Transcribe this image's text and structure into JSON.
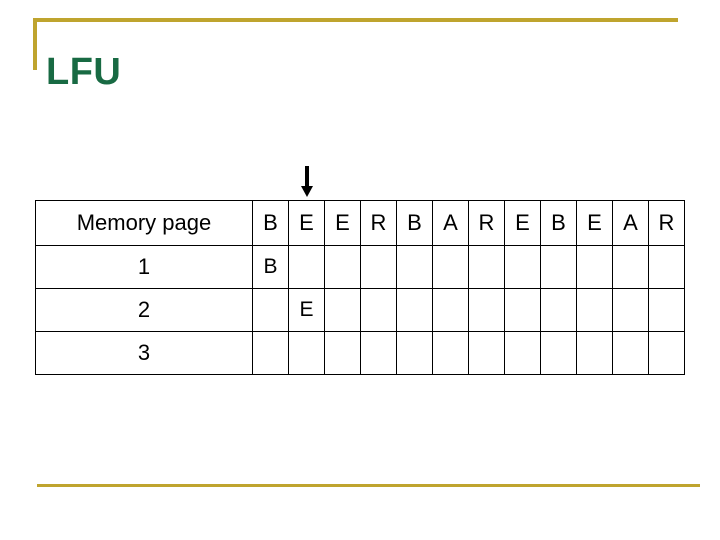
{
  "slide": {
    "title": "LFU",
    "title_color": "#186a43",
    "rule_color": "#bfa42e"
  },
  "marker": {
    "icon": "down-arrow-icon",
    "points_to_column_index": 1,
    "color": "#000000"
  },
  "table": {
    "row_label_header": "Memory page",
    "reference_string": [
      "B",
      "E",
      "E",
      "R",
      "B",
      "A",
      "R",
      "E",
      "B",
      "E",
      "A",
      "R"
    ],
    "row_labels": [
      "1",
      "2",
      "3"
    ],
    "fill_color": "#c18ad8",
    "rows": [
      {
        "label": "1",
        "cells": [
          "B",
          "",
          "",
          "",
          "",
          "",
          "",
          "",
          "",
          "",
          "",
          ""
        ]
      },
      {
        "label": "2",
        "cells": [
          "",
          "E",
          "",
          "",
          "",
          "",
          "",
          "",
          "",
          "",
          "",
          ""
        ]
      },
      {
        "label": "3",
        "cells": [
          "",
          "",
          "",
          "",
          "",
          "",
          "",
          "",
          "",
          "",
          "",
          ""
        ]
      }
    ]
  }
}
